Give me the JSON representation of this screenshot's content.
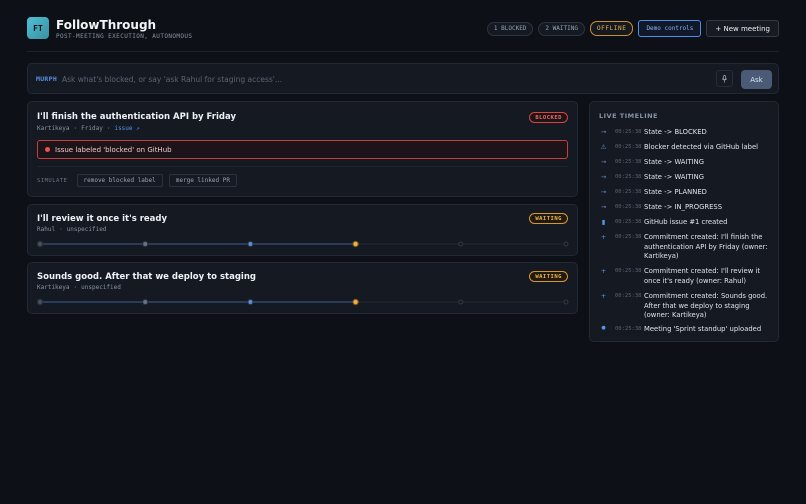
{
  "app": {
    "logo_text": "FT",
    "title": "FollowThrough",
    "subtitle": "POST-MEETING EXECUTION, AUTONOMOUS"
  },
  "header": {
    "blocked_count": "1 BLOCKED",
    "waiting_count": "2 WAITING",
    "status": "OFFLINE",
    "demo_button": "Demo controls",
    "new_meeting_button": "+ New meeting"
  },
  "search": {
    "tag": "MURPH",
    "placeholder": "Ask what's blocked, or say 'ask Rahul for staging access'...",
    "value": "",
    "ask_button": "Ask",
    "mic_icon": "microphone-icon"
  },
  "commitments": [
    {
      "title": "I'll finish the authentication API by Friday",
      "owner": "Kartikeya",
      "due": "Friday",
      "link": "issue ↗",
      "status": "BLOCKED",
      "alert": "Issue labeled 'blocked' on GitHub",
      "simulate_label": "SIMULATE",
      "actions": [
        "remove blocked label",
        "merge linked PR"
      ]
    },
    {
      "title": "I'll review it once it's ready",
      "owner": "Rahul",
      "due": "unspecified",
      "status": "WAITING",
      "progress_stage": 4,
      "progress_total": 6
    },
    {
      "title": "Sounds good. After that we deploy to staging",
      "owner": "Kartikeya",
      "due": "unspecified",
      "status": "WAITING",
      "progress_stage": 4,
      "progress_total": 6
    }
  ],
  "timeline": {
    "heading": "LIVE TIMELINE",
    "items": [
      {
        "icon": "→",
        "icon_name": "arrow-right-icon",
        "time": "00:25:38",
        "text": "State -> BLOCKED"
      },
      {
        "icon": "⚠",
        "icon_name": "warning-icon",
        "time": "00:25:38",
        "text": "Blocker detected via GitHub label"
      },
      {
        "icon": "→",
        "icon_name": "arrow-right-icon",
        "time": "00:25:38",
        "text": "State -> WAITING"
      },
      {
        "icon": "→",
        "icon_name": "arrow-right-icon",
        "time": "00:25:38",
        "text": "State -> WAITING"
      },
      {
        "icon": "→",
        "icon_name": "arrow-right-icon",
        "time": "00:25:38",
        "text": "State -> PLANNED"
      },
      {
        "icon": "→",
        "icon_name": "arrow-right-icon",
        "time": "00:25:38",
        "text": "State -> IN_PROGRESS"
      },
      {
        "icon": "▮",
        "icon_name": "clipboard-icon",
        "time": "00:25:38",
        "text": "GitHub issue #1 created"
      },
      {
        "icon": "+",
        "icon_name": "plus-icon",
        "time": "00:25:38",
        "text": "Commitment created: I'll finish the authentication API by Friday (owner: Kartikeya)"
      },
      {
        "icon": "+",
        "icon_name": "plus-icon",
        "time": "00:25:38",
        "text": "Commitment created: I'll review it once it's ready (owner: Rahul)"
      },
      {
        "icon": "+",
        "icon_name": "plus-icon",
        "time": "00:25:38",
        "text": "Commitment created: Sounds good. After that we deploy to staging (owner: Kartikeya)"
      },
      {
        "icon": "●",
        "icon_name": "upload-dot-icon",
        "time": "00:25:38",
        "text": "Meeting 'Sprint standup' uploaded"
      }
    ]
  },
  "colors": {
    "accent_blue": "#4d8fe4",
    "blocked_red": "#d8433f",
    "waiting_amber": "#f1b447"
  }
}
